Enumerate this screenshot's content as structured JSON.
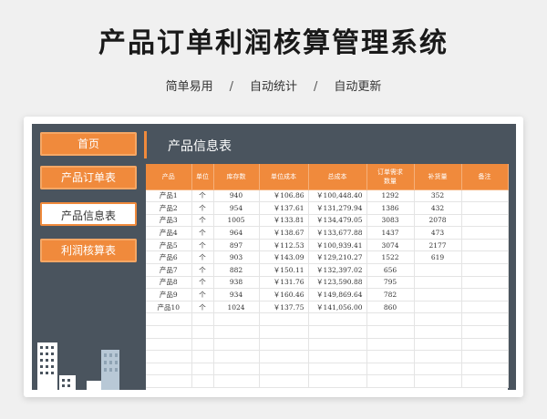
{
  "header": {
    "title": "产品订单利润核算管理系统",
    "subtitle_items": [
      "简单易用",
      "自动统计",
      "自动更新"
    ],
    "separator": "/"
  },
  "sidebar": {
    "items": [
      {
        "label": "首页",
        "style": "orange"
      },
      {
        "label": "产品订单表",
        "style": "orange"
      },
      {
        "label": "产品信息表",
        "style": "white",
        "active": true
      },
      {
        "label": "利润核算表",
        "style": "orange"
      }
    ]
  },
  "main": {
    "section_title": "产品信息表",
    "table": {
      "columns": [
        "产品",
        "单位",
        "库存数",
        "单位成本",
        "总成本",
        "订单需求\n数量",
        "补货量",
        "备注"
      ],
      "rows": [
        [
          "产品1",
          "个",
          "940",
          "￥106.86",
          "￥100,448.40",
          "1292",
          "352",
          ""
        ],
        [
          "产品2",
          "个",
          "954",
          "￥137.61",
          "￥131,279.94",
          "1386",
          "432",
          ""
        ],
        [
          "产品3",
          "个",
          "1005",
          "￥133.81",
          "￥134,479.05",
          "3083",
          "2078",
          ""
        ],
        [
          "产品4",
          "个",
          "964",
          "￥138.67",
          "￥133,677.88",
          "1437",
          "473",
          ""
        ],
        [
          "产品5",
          "个",
          "897",
          "￥112.53",
          "￥100,939.41",
          "3074",
          "2177",
          ""
        ],
        [
          "产品6",
          "个",
          "903",
          "￥143.09",
          "￥129,210.27",
          "1522",
          "619",
          ""
        ],
        [
          "产品7",
          "个",
          "882",
          "￥150.11",
          "￥132,397.02",
          "656",
          "",
          ""
        ],
        [
          "产品8",
          "个",
          "938",
          "￥131.76",
          "￥123,590.88",
          "795",
          "",
          ""
        ],
        [
          "产品9",
          "个",
          "934",
          "￥160.46",
          "￥149,869.64",
          "782",
          "",
          ""
        ],
        [
          "产品10",
          "个",
          "1024",
          "￥137.75",
          "￥141,056.00",
          "860",
          "",
          ""
        ]
      ],
      "empty_rows": 6
    }
  },
  "colors": {
    "accent": "#f08a3c",
    "panel": "#4a545e"
  }
}
